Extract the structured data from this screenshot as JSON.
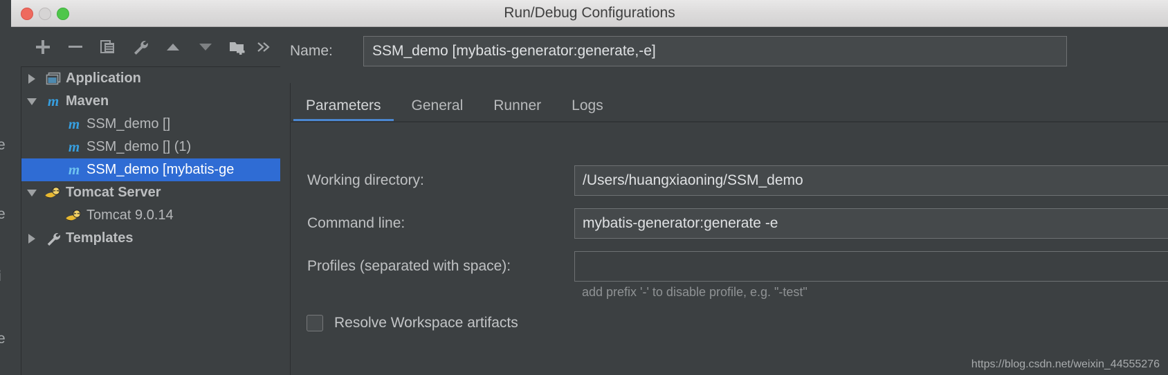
{
  "window": {
    "title": "Run/Debug Configurations",
    "traffic_lights": [
      "close",
      "minimize",
      "zoom"
    ]
  },
  "background_fragments": [
    "e",
    "e",
    "i",
    "e"
  ],
  "toolbar": {
    "buttons": [
      {
        "name": "add-button",
        "icon": "plus-icon"
      },
      {
        "name": "remove-button",
        "icon": "minus-icon"
      },
      {
        "name": "copy-configuration-button",
        "icon": "copy-icon"
      },
      {
        "name": "edit-templates-button",
        "icon": "wrench-icon"
      },
      {
        "name": "move-up-button",
        "icon": "arrow-up-icon"
      },
      {
        "name": "move-down-button",
        "icon": "arrow-down-icon"
      },
      {
        "name": "create-folder-button",
        "icon": "new-folder-icon"
      },
      {
        "name": "more-options-button",
        "icon": "chevron-double-right-icon"
      }
    ]
  },
  "tree": {
    "nodes": [
      {
        "label": "Application",
        "icon": "application-icon",
        "twisty": "right",
        "depth": 0,
        "bold": true,
        "selected": false
      },
      {
        "label": "Maven",
        "icon": "maven-icon",
        "twisty": "down",
        "depth": 0,
        "bold": true,
        "selected": false
      },
      {
        "label": "SSM_demo []",
        "icon": "maven-icon",
        "twisty": "none",
        "depth": 1,
        "bold": false,
        "selected": false
      },
      {
        "label": "SSM_demo [] (1)",
        "icon": "maven-icon",
        "twisty": "none",
        "depth": 1,
        "bold": false,
        "selected": false
      },
      {
        "label": "SSM_demo [mybatis-ge",
        "icon": "maven-icon",
        "twisty": "none",
        "depth": 1,
        "bold": false,
        "selected": true
      },
      {
        "label": "Tomcat Server",
        "icon": "tomcat-icon",
        "twisty": "down",
        "depth": 0,
        "bold": true,
        "selected": false
      },
      {
        "label": "Tomcat 9.0.14",
        "icon": "tomcat-icon",
        "twisty": "none",
        "depth": 1,
        "bold": false,
        "selected": false
      },
      {
        "label": "Templates",
        "icon": "wrench-icon",
        "twisty": "right",
        "depth": 0,
        "bold": true,
        "selected": false
      }
    ]
  },
  "name_row": {
    "label": "Name:",
    "value": "SSM_demo [mybatis-generator:generate,-e]",
    "placeholder": ""
  },
  "tabs": [
    {
      "label": "Parameters",
      "active": true
    },
    {
      "label": "General",
      "active": false
    },
    {
      "label": "Runner",
      "active": false
    },
    {
      "label": "Logs",
      "active": false
    }
  ],
  "parameters": {
    "working_directory": {
      "label": "Working directory:",
      "value": "/Users/huangxiaoning/SSM_demo"
    },
    "command_line": {
      "label": "Command line:",
      "value": "mybatis-generator:generate -e"
    },
    "profiles": {
      "label": "Profiles (separated with space):",
      "value": "",
      "hint": "add prefix '-' to disable profile, e.g. \"-test\""
    },
    "resolve_workspace_artifacts": {
      "label": "Resolve Workspace artifacts",
      "checked": false
    }
  },
  "watermark": "https://blog.csdn.net/weixin_44555276",
  "colors": {
    "window_bg": "#3c4042",
    "titlebar_bg": "#dcdbdb",
    "selection_blue": "#2f6cd4",
    "tab_underline": "#4b87d0",
    "maven_icon_blue": "#379fe0",
    "tomcat_icon_yellow": "#e8b830",
    "field_bg": "#45494b",
    "field_border": "#6e7173",
    "text_primary": "#bfc1c3",
    "text_secondary": "#8f9294"
  }
}
